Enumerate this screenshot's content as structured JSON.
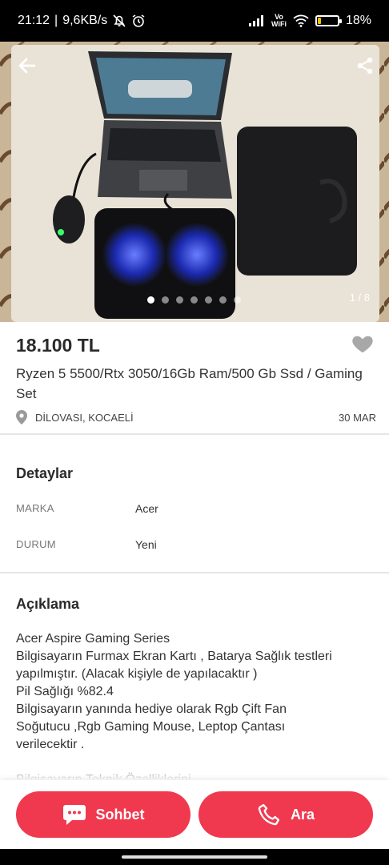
{
  "status_bar": {
    "time": "21:12",
    "net_speed": "9,6KB/s",
    "volte_top": "Vo",
    "volte_bottom": "WiFi",
    "battery": "18%",
    "battery_level": 0.18
  },
  "photo": {
    "counter": "1 / 8",
    "total_images": 8,
    "current_index": 1
  },
  "listing": {
    "price": "18.100 TL",
    "title": "Ryzen 5 5500/Rtx 3050/16Gb Ram/500 Gb Ssd / Gaming Set",
    "location": "DİLOVASI, KOCAELİ",
    "date": "30 MAR"
  },
  "details": {
    "heading": "Detaylar",
    "rows": [
      {
        "key": "MARKA",
        "value": "Acer"
      },
      {
        "key": "DURUM",
        "value": "Yeni"
      }
    ]
  },
  "description": {
    "heading": "Açıklama",
    "lines": [
      "Acer Aspire Gaming Series",
      "Bilgisayarın Furmax Ekran Kartı , Batarya Sağlık testleri",
      "yapılmıştır. (Alacak kişiyle de yapılacaktır )",
      "Pil Sağlığı %82.4",
      "Bilgisayarın yanında hediye olarak Rgb Çift Fan",
      "Soğutucu ,Rgb Gaming Mouse, Leptop Çantası",
      "verilecektir .",
      "",
      "Bilgisayarın Teknik Özelliklerini"
    ]
  },
  "actions": {
    "chat_label": "Sohbet",
    "call_label": "Ara"
  },
  "colors": {
    "accent": "#f0394e",
    "status_bar": "#000000",
    "battery": "#f5c400"
  }
}
